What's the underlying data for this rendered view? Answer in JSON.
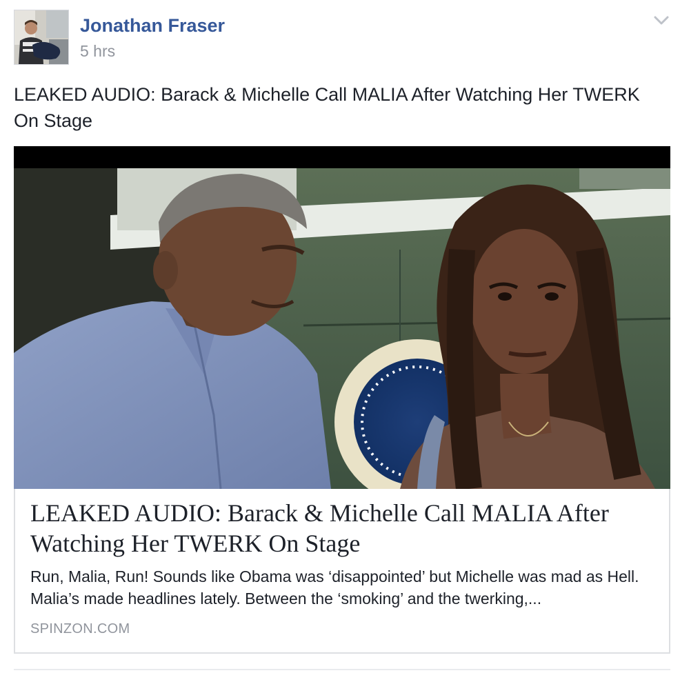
{
  "post": {
    "author": "Jonathan Fraser",
    "timestamp": "5 hrs",
    "text": "LEAKED AUDIO: Barack & Michelle Call MALIA After Watching Her TWERK On Stage"
  },
  "link_preview": {
    "title": "LEAKED AUDIO: Barack & Michelle Call MALIA After Watching Her TWERK On Stage",
    "description": "Run, Malia, Run! Sounds like Obama was ‘disappointed’ but Michelle was mad as Hell. Malia’s made headlines lately. Between the ‘smoking’ and the twerking,...",
    "domain": "SPINZON.COM"
  },
  "icons": {
    "options": "chevron-down-icon"
  },
  "colors": {
    "author_link": "#365899",
    "meta_gray": "#90949c",
    "text": "#1d2129",
    "border": "#dddfe2"
  }
}
